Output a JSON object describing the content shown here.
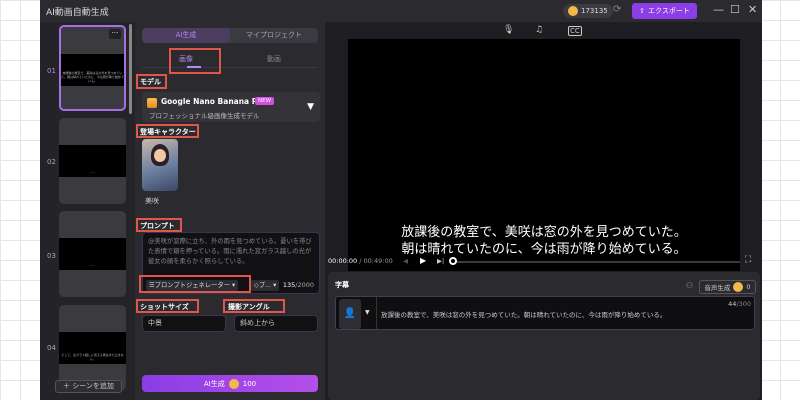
{
  "app": {
    "title": "AI動画自動生成",
    "coins": "173135",
    "export_label": "エクスポート"
  },
  "scenes": {
    "items": [
      {
        "num": "01",
        "caption": "放課後の教室で、美咲は窓の外を見つめていた。朝は晴れていたのに、今は雨が降り始めている。"
      },
      {
        "num": "02",
        "caption": "……"
      },
      {
        "num": "03",
        "caption": "……"
      },
      {
        "num": "04",
        "caption": "そして、窓ガラス越しに見える雨はまだ止まない。"
      }
    ],
    "add_label": "シーンを追加"
  },
  "panel": {
    "tabs": [
      "AI生成",
      "マイプロジェクト"
    ],
    "subtabs": [
      "画像",
      "動画"
    ],
    "model_label": "モデル",
    "model_name": "Google Nano Banana Pro",
    "model_badge": "NEW",
    "model_desc": "プロフェッショナル級画像生成モデル",
    "character_label": "登場キャラクター",
    "character_name": "美咲",
    "prompt_label": "プロンプト",
    "prompt_text": "@美咲が窓際に立ち、外の雨を見つめている。憂いを帯びた表情で頬を押っている。雨に濡れた窓ガラス越しの光が彼女の顔を柔らかく照らしている。",
    "prompt_generator": "プロンプトジェネレーター",
    "style_btn": "プ...",
    "count_used": "135",
    "count_max": "/2000",
    "shot_label": "ショットサイズ",
    "shot_value": "中景",
    "angle_label": "撮影アングル",
    "angle_value": "斜め上から",
    "generate_label": "AI生成",
    "generate_cost": "100"
  },
  "preview": {
    "subtitle_line1": "放課後の教室で、美咲は窓の外を見つめていた。",
    "subtitle_line2": "朝は晴れていたのに、今は雨が降り始めている。",
    "time_current": "00:00:00",
    "time_total": "/ 00:49:00",
    "progress": 0
  },
  "captions": {
    "label": "字幕",
    "voice_label": "音声生成",
    "voice_cost": "0",
    "text": "放課後の教室で、美咲は窓の外を見つめていた。朝は晴れていたのに、今は雨が降り始めている。",
    "count_used": "44",
    "count_max": "/300"
  },
  "colors": {
    "accent": "#8b3de6",
    "highlight_box": "#e0564a"
  }
}
